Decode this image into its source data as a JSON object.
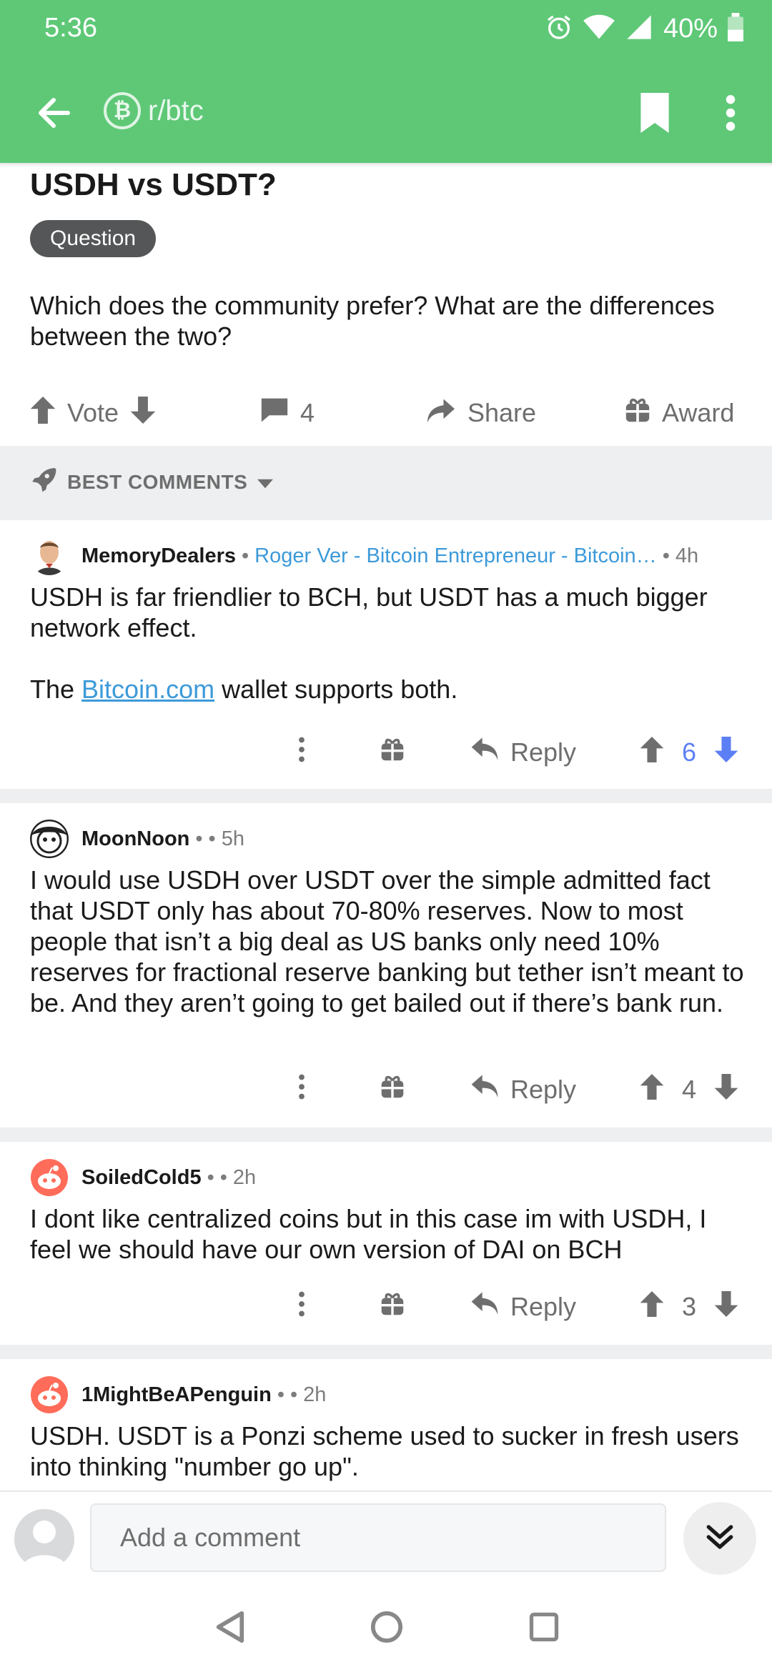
{
  "status": {
    "time": "5:36",
    "battery": "40%"
  },
  "header": {
    "subreddit": "r/btc",
    "sub_icon_glyph": "₿"
  },
  "post": {
    "title": "USDH vs USDT?",
    "flair": "Question",
    "body": "Which does the community prefer? What are the differences between the two?",
    "vote_label": "Vote",
    "comment_count": "4",
    "share_label": "Share",
    "award_label": "Award"
  },
  "sort": {
    "label": "BEST COMMENTS"
  },
  "comments": [
    {
      "author": "MemoryDealers",
      "flair": "Roger Ver - Bitcoin Entrepreneur - Bitcoin…",
      "time": "4h",
      "body_line1": "USDH is far friendlier to BCH, but USDT has a much bigger network effect.",
      "body_pre": "The ",
      "body_link": "Bitcoin.com",
      "body_post": " wallet supports both.",
      "reply_label": "Reply",
      "score": "6"
    },
    {
      "author": "MoonNoon",
      "time": "5h",
      "body": "I would use USDH over USDT over the simple admitted fact that USDT only has about 70-80% reserves. Now to most people that isn’t a big deal as US banks only need 10% reserves for fractional reserve banking but tether isn’t meant to be. And they aren’t going to get bailed out if there’s bank run.",
      "reply_label": "Reply",
      "score": "4"
    },
    {
      "author": "SoiledCold5",
      "time": "2h",
      "body": "I dont like centralized coins but in this case im with USDH, I feel we should have our own version of DAI on BCH",
      "reply_label": "Reply",
      "score": "3"
    },
    {
      "author": "1MightBeAPenguin",
      "time": "2h",
      "body": "USDH. USDT is a Ponzi scheme used to sucker in fresh users into thinking \"number go up\"."
    }
  ],
  "compose": {
    "placeholder": "Add a comment"
  },
  "colors": {
    "brand_green": "#5ec877",
    "link_blue": "#3d9ad9",
    "downvote_blue": "#5d7ff5"
  }
}
